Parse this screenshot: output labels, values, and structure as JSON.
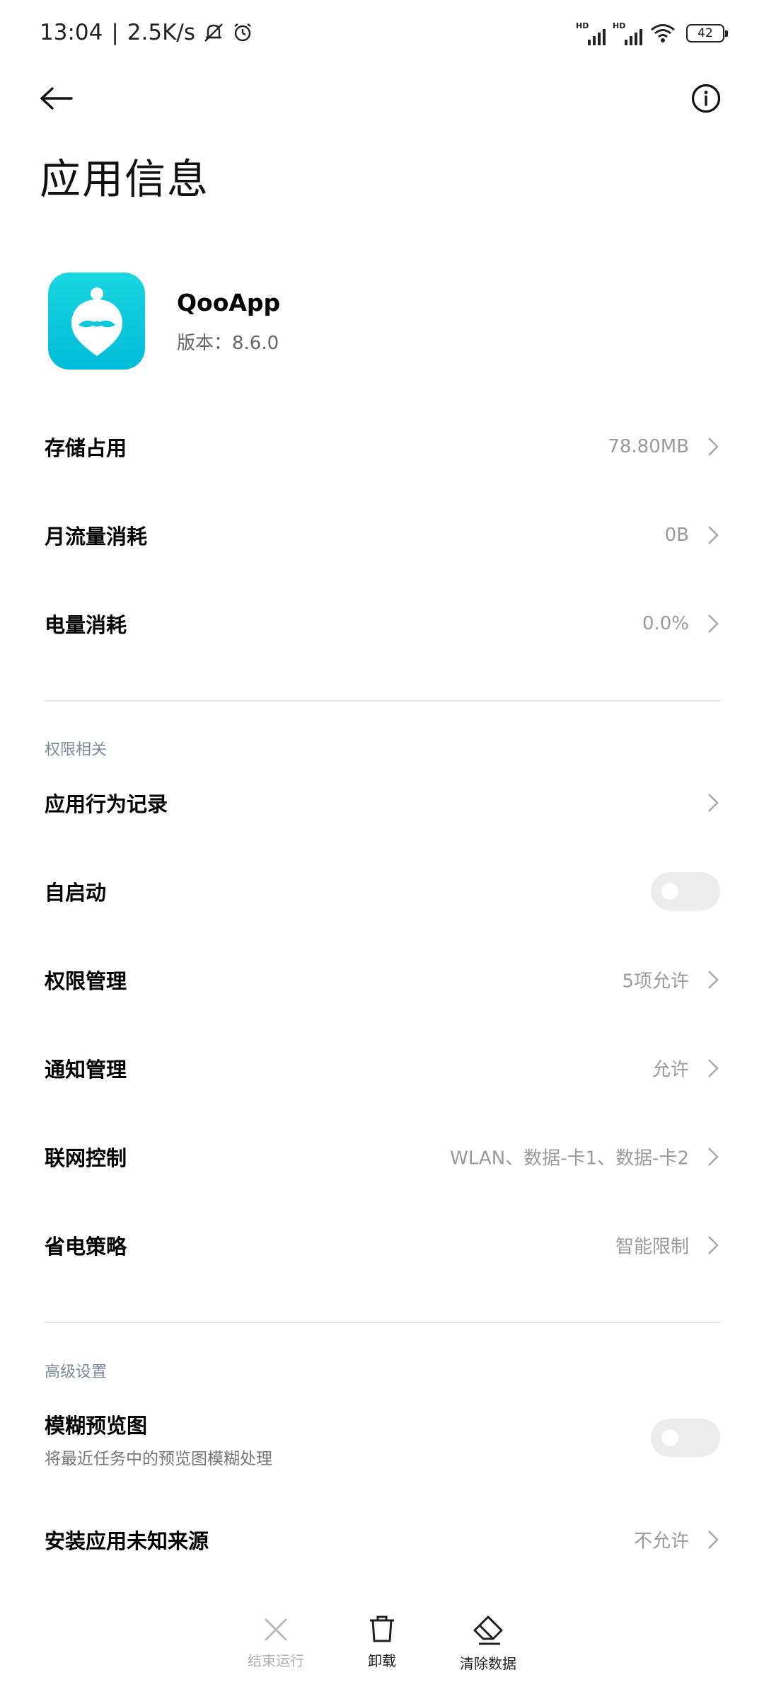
{
  "status_bar": {
    "time": "13:04",
    "speed": "2.5K/s",
    "battery": "42",
    "icons": [
      "mute-vibrate-icon",
      "alarm-icon",
      "hd-signal-icon",
      "wifi-icon",
      "battery-icon"
    ]
  },
  "header": {
    "title": "应用信息"
  },
  "app": {
    "name": "QooApp",
    "version": "版本：8.6.0",
    "icon_color": "#00c4dc"
  },
  "rows_top": [
    {
      "label": "存储占用",
      "value": "78.80MB"
    },
    {
      "label": "月流量消耗",
      "value": "0B"
    },
    {
      "label": "电量消耗",
      "value": "0.0%"
    }
  ],
  "section_permissions": "权限相关",
  "rows_permissions": [
    {
      "label": "应用行为记录",
      "value": ""
    },
    {
      "label": "自启动",
      "toggle": false
    },
    {
      "label": "权限管理",
      "value": "5项允许"
    },
    {
      "label": "通知管理",
      "value": "允许"
    },
    {
      "label": "联网控制",
      "value": "WLAN、数据-卡1、数据-卡2"
    },
    {
      "label": "省电策略",
      "value": "智能限制"
    }
  ],
  "section_advanced": "高级设置",
  "rows_advanced": [
    {
      "label": "模糊预览图",
      "sub": "将最近任务中的预览图模糊处理",
      "toggle": false
    },
    {
      "label": "安装应用未知来源",
      "value": "不允许"
    }
  ],
  "bottom_bar": {
    "force_stop": "结束运行",
    "uninstall": "卸载",
    "clear_data": "清除数据"
  }
}
